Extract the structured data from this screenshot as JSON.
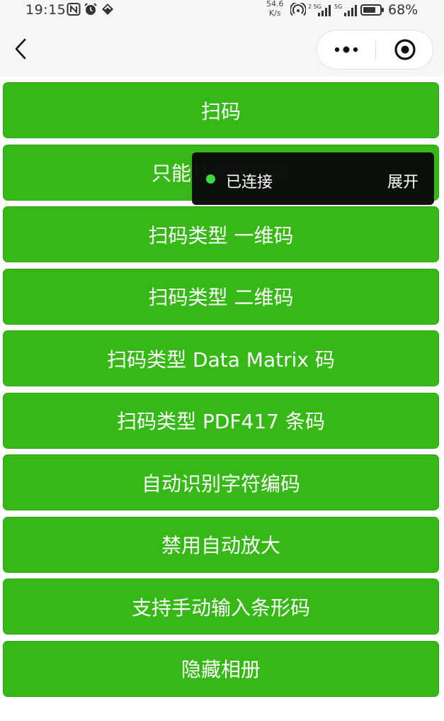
{
  "status_bar": {
    "time": "19:15",
    "net_speed_value": "54.6",
    "net_speed_unit": "K/s",
    "battery_percent": "68%",
    "icons": [
      "nfc-icon",
      "alarm-icon",
      "app-notification-icon",
      "hotspot-icon",
      "signal-5g-icon",
      "signal-5g-icon",
      "battery-icon"
    ]
  },
  "nav": {
    "back_icon": "chevron-left-icon",
    "menu_icon": "more-dots-icon",
    "close_icon": "target-circle-icon"
  },
  "buttons": [
    "扫码",
    "只能从相机扫码",
    "扫码类型 一维码",
    "扫码类型 二维码",
    "扫码类型 Data Matrix 码",
    "扫码类型 PDF417 条码",
    "自动识别字符编码",
    "禁用自动放大",
    "支持手动输入条形码",
    "隐藏相册"
  ],
  "toast": {
    "status": "已连接",
    "action": "展开",
    "dot_color": "#3ddc3d"
  },
  "colors": {
    "button_bg": "#36b816",
    "nav_bg": "#f6f6f6"
  }
}
